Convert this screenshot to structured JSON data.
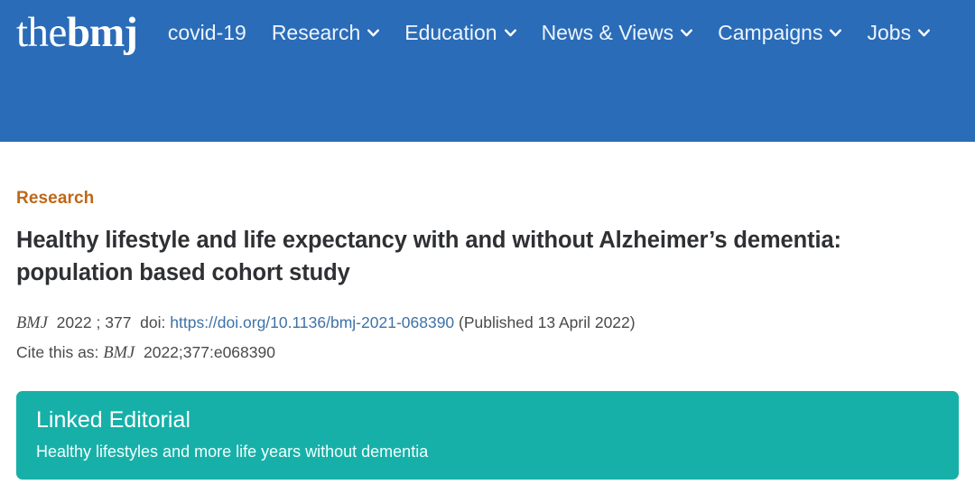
{
  "header": {
    "background_color": "#2a6cb8",
    "brand": {
      "light_part": "the",
      "bold_part": "bmj",
      "full": "the bmj"
    },
    "nav": [
      {
        "label": "covid-19",
        "has_dropdown": false
      },
      {
        "label": "Research",
        "has_dropdown": true,
        "icon": "chevron-down-icon"
      },
      {
        "label": "Education",
        "has_dropdown": true,
        "icon": "chevron-down-icon"
      },
      {
        "label": "News & Views",
        "has_dropdown": true,
        "icon": "chevron-down-icon"
      },
      {
        "label": "Campaigns",
        "has_dropdown": true,
        "icon": "chevron-down-icon"
      },
      {
        "label": "Jobs",
        "has_dropdown": true,
        "icon": "chevron-down-icon"
      }
    ]
  },
  "article": {
    "kicker": "Research",
    "kicker_color": "#bf6718",
    "title": "Healthy lifestyle and life expectancy with and without Alzheimer’s dementia: population based cohort study",
    "citation": {
      "journal": "BMJ",
      "year": "2022",
      "separator": ";",
      "volume": "377",
      "doi_label": "doi:",
      "doi_url": "https://doi.org/10.1136/bmj-2021-068390",
      "doi_color": "#3f72a8",
      "published": "(Published 13 April 2022)"
    },
    "cite_this_as": {
      "prefix": "Cite this as:",
      "journal": "BMJ",
      "reference": "2022;377:e068390"
    }
  },
  "linked_editorial": {
    "background_color": "#17b0a8",
    "title": "Linked Editorial",
    "subtitle": "Healthy lifestyles and more life years without dementia"
  }
}
